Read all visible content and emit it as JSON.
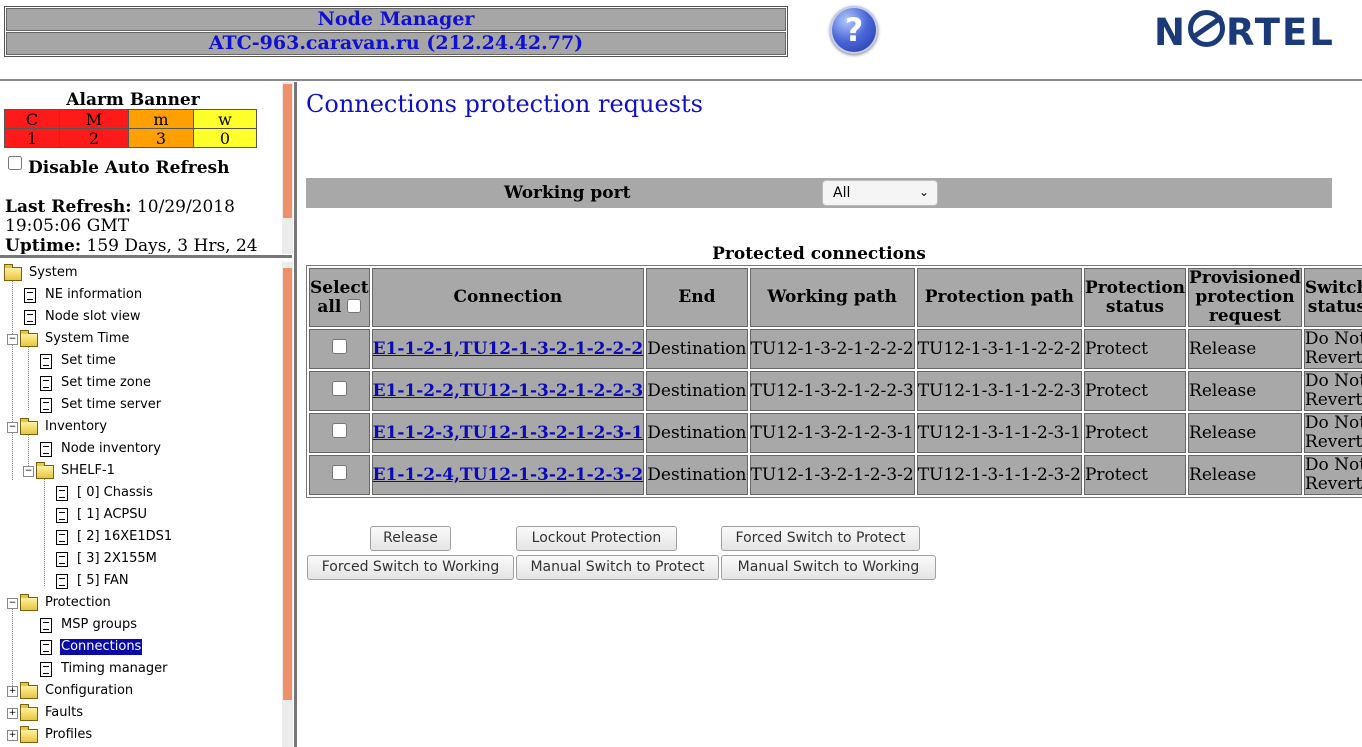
{
  "header": {
    "title": "Node Manager",
    "node": "ATC-963.caravan.ru (212.24.42.77)",
    "help_icon": "question-mark-icon",
    "help_glyph": "?",
    "logo_pre": "N",
    "logo_post": "RTEL"
  },
  "alarm_banner": {
    "title": "Alarm Banner",
    "levels": [
      {
        "label": "C",
        "count": "1",
        "color": "#ff1a1a"
      },
      {
        "label": "M",
        "count": "2",
        "color": "#ff1a1a"
      },
      {
        "label": "m",
        "count": "3",
        "color": "#ffa000"
      },
      {
        "label": "w",
        "count": "0",
        "color": "#ffff2a"
      }
    ],
    "disable_auto_refresh": "Disable Auto Refresh",
    "last_refresh_label": "Last Refresh:",
    "last_refresh_value": "10/29/2018",
    "last_refresh_time": "19:05:06 GMT",
    "uptime_label": "Uptime:",
    "uptime_value": "159 Days, 3 Hrs, 24"
  },
  "tree": [
    {
      "label": "System",
      "type": "folder",
      "expanded": true
    },
    {
      "label": "NE information",
      "type": "doc"
    },
    {
      "label": "Node slot view",
      "type": "doc"
    },
    {
      "label": "System Time",
      "type": "folder",
      "expanded": true
    },
    {
      "label": "Set time",
      "type": "doc"
    },
    {
      "label": "Set time zone",
      "type": "doc"
    },
    {
      "label": "Set time server",
      "type": "doc"
    },
    {
      "label": "Inventory",
      "type": "folder",
      "expanded": true
    },
    {
      "label": "Node inventory",
      "type": "doc"
    },
    {
      "label": "SHELF-1",
      "type": "folder",
      "expanded": true
    },
    {
      "label": "[ 0] Chassis",
      "type": "doc"
    },
    {
      "label": "[ 1] ACPSU",
      "type": "doc"
    },
    {
      "label": "[ 2] 16XE1DS1",
      "type": "doc"
    },
    {
      "label": "[ 3] 2X155M",
      "type": "doc"
    },
    {
      "label": "[ 5] FAN",
      "type": "doc"
    },
    {
      "label": "Protection",
      "type": "folder",
      "expanded": true
    },
    {
      "label": "MSP groups",
      "type": "doc"
    },
    {
      "label": "Connections",
      "type": "doc",
      "selected": true
    },
    {
      "label": "Timing manager",
      "type": "doc"
    },
    {
      "label": "Configuration",
      "type": "folder",
      "expanded": false
    },
    {
      "label": "Faults",
      "type": "folder",
      "expanded": false
    },
    {
      "label": "Profiles",
      "type": "folder",
      "expanded": false
    }
  ],
  "main": {
    "page_title": "Connections protection requests",
    "filter": {
      "label": "Working port",
      "selected": "All"
    },
    "table_caption": "Protected connections",
    "columns": {
      "select_all": "Select all",
      "connection": "Connection",
      "end": "End",
      "working_path": "Working path",
      "protection_path": "Protection path",
      "protection_status": "Protection status",
      "provisioned_request": "Provisioned protection request",
      "switch_status": "Switch status"
    },
    "rows": [
      {
        "connection": "E1-1-2-1,TU12-1-3-2-1-2-2-2",
        "end": "Destination",
        "working_path": "TU12-1-3-2-1-2-2-2",
        "protection_path": "TU12-1-3-1-1-2-2-2",
        "protection_status": "Protect",
        "provisioned_request": "Release",
        "switch_status": "Do Not Revert"
      },
      {
        "connection": "E1-1-2-2,TU12-1-3-2-1-2-2-3",
        "end": "Destination",
        "working_path": "TU12-1-3-2-1-2-2-3",
        "protection_path": "TU12-1-3-1-1-2-2-3",
        "protection_status": "Protect",
        "provisioned_request": "Release",
        "switch_status": "Do Not Revert"
      },
      {
        "connection": "E1-1-2-3,TU12-1-3-2-1-2-3-1",
        "end": "Destination",
        "working_path": "TU12-1-3-2-1-2-3-1",
        "protection_path": "TU12-1-3-1-1-2-3-1",
        "protection_status": "Protect",
        "provisioned_request": "Release",
        "switch_status": "Do Not Revert"
      },
      {
        "connection": "E1-1-2-4,TU12-1-3-2-1-2-3-2",
        "end": "Destination",
        "working_path": "TU12-1-3-2-1-2-3-2",
        "protection_path": "TU12-1-3-1-1-2-3-2",
        "protection_status": "Protect",
        "provisioned_request": "Release",
        "switch_status": "Do Not Revert"
      }
    ],
    "buttons": {
      "release": "Release",
      "lockout": "Lockout Protection",
      "forced_protect": "Forced Switch to Protect",
      "forced_working": "Forced Switch to Working",
      "manual_protect": "Manual Switch to Protect",
      "manual_working": "Manual Switch to Working"
    }
  }
}
